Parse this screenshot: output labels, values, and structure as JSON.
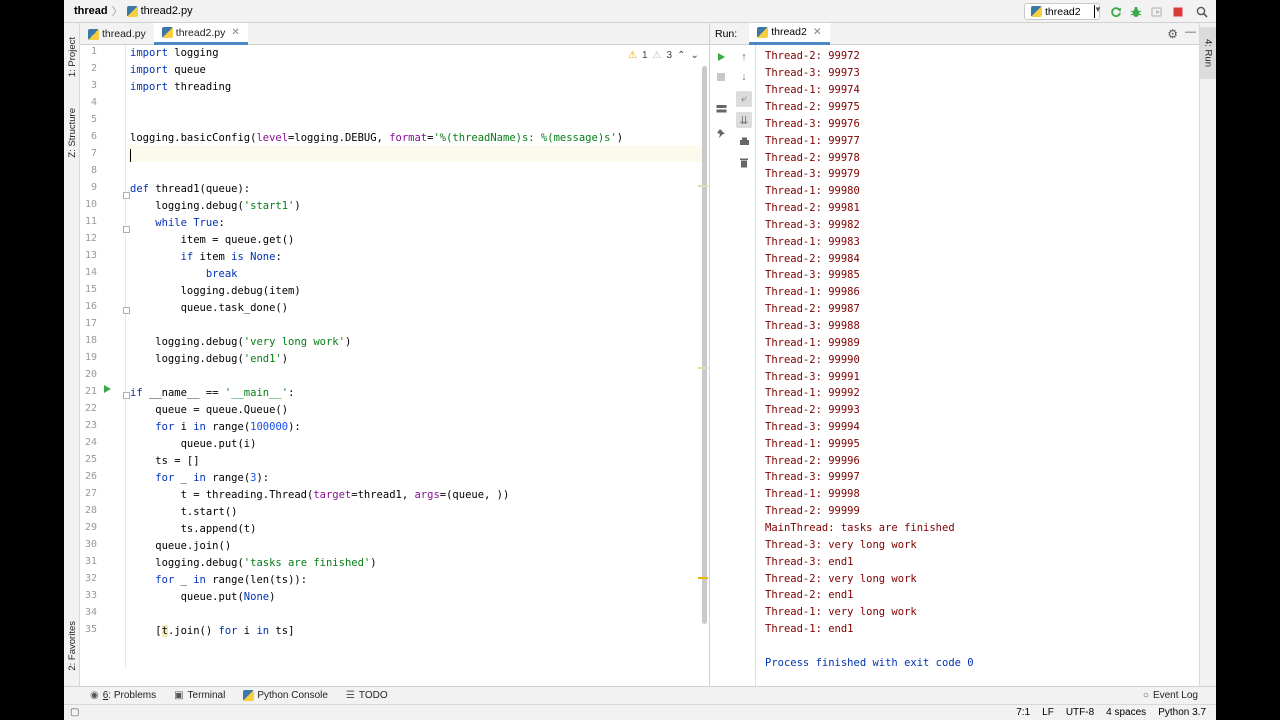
{
  "breadcrumb": {
    "project": "thread",
    "file": "thread2.py"
  },
  "toolbar": {
    "run_config": "thread2"
  },
  "left_tools": {
    "project": "1: Project",
    "structure": "Z: Structure",
    "favorites": "2: Favorites"
  },
  "right_tools": {
    "run": "4: Run"
  },
  "editor": {
    "tabs": [
      {
        "label": "thread.py"
      },
      {
        "label": "thread2.py"
      }
    ],
    "inspections": {
      "warnings": "1",
      "weak_warnings": "3"
    },
    "line_numbers": [
      "1",
      "2",
      "3",
      "4",
      "5",
      "6",
      "7",
      "8",
      "9",
      "10",
      "11",
      "12",
      "13",
      "14",
      "15",
      "16",
      "17",
      "18",
      "19",
      "20",
      "21",
      "22",
      "23",
      "24",
      "25",
      "26",
      "27",
      "28",
      "29",
      "30",
      "31",
      "32",
      "33",
      "34",
      "35"
    ]
  },
  "run_panel": {
    "label": "Run:",
    "tab": "thread2",
    "output": [
      "Thread-2: 99972",
      "Thread-3: 99973",
      "Thread-1: 99974",
      "Thread-2: 99975",
      "Thread-3: 99976",
      "Thread-1: 99977",
      "Thread-2: 99978",
      "Thread-3: 99979",
      "Thread-1: 99980",
      "Thread-2: 99981",
      "Thread-3: 99982",
      "Thread-1: 99983",
      "Thread-2: 99984",
      "Thread-3: 99985",
      "Thread-1: 99986",
      "Thread-2: 99987",
      "Thread-3: 99988",
      "Thread-1: 99989",
      "Thread-2: 99990",
      "Thread-3: 99991",
      "Thread-1: 99992",
      "Thread-2: 99993",
      "Thread-3: 99994",
      "Thread-1: 99995",
      "Thread-2: 99996",
      "Thread-3: 99997",
      "Thread-1: 99998",
      "Thread-2: 99999",
      "MainThread: tasks are finished",
      "Thread-3: very long work",
      "Thread-3: end1",
      "Thread-2: very long work",
      "Thread-2: end1",
      "Thread-1: very long work",
      "Thread-1: end1"
    ],
    "finished": "Process finished with exit code 0"
  },
  "bottom_tools": {
    "problems_num": "6",
    "problems": ": Problems",
    "terminal": "Terminal",
    "python_console": "Python Console",
    "todo": "TODO",
    "event_log": "Event Log"
  },
  "status": {
    "position": "7:1",
    "line_sep": "LF",
    "encoding": "UTF-8",
    "indent": "4 spaces",
    "interpreter": "Python 3.7"
  },
  "colors": {
    "accent": "#4a88c7",
    "run_green": "#3da847",
    "stop_red": "#db3b3b",
    "output_red": "#7f0000"
  }
}
